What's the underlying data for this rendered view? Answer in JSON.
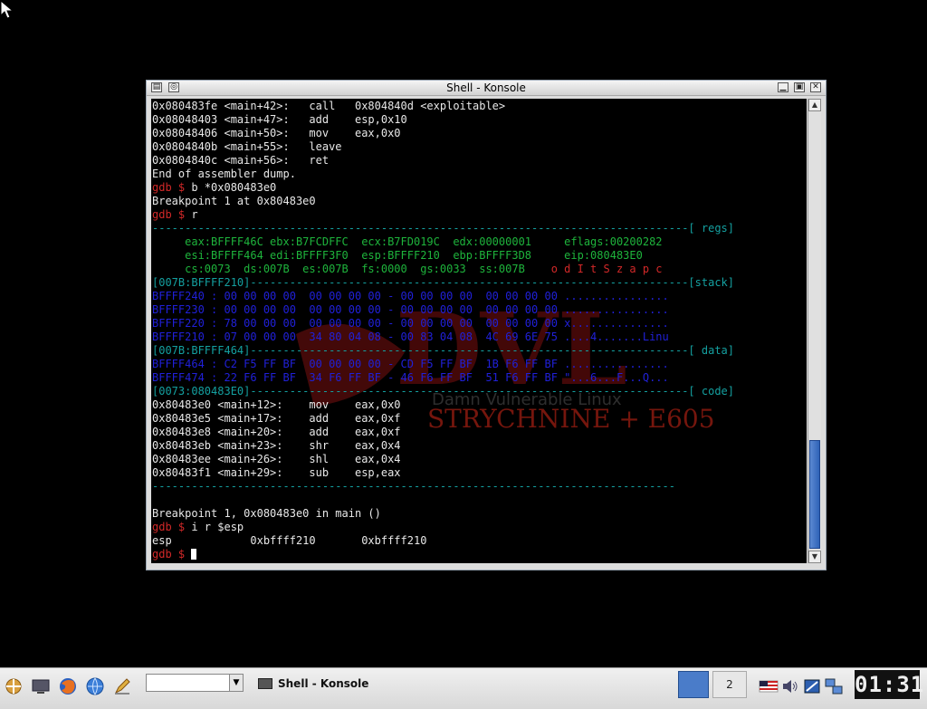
{
  "window": {
    "title": "Shell - Konsole"
  },
  "terminal": {
    "lines": [
      {
        "segments": [
          {
            "text": "0x080483fe <main+42>:   call   0x804840d <exploitable>",
            "cls": "c-white"
          }
        ]
      },
      {
        "segments": [
          {
            "text": "0x08048403 <main+47>:   add    esp,0x10",
            "cls": "c-white"
          }
        ]
      },
      {
        "segments": [
          {
            "text": "0x08048406 <main+50>:   mov    eax,0x0",
            "cls": "c-white"
          }
        ]
      },
      {
        "segments": [
          {
            "text": "0x0804840b <main+55>:   leave",
            "cls": "c-white"
          }
        ]
      },
      {
        "segments": [
          {
            "text": "0x0804840c <main+56>:   ret",
            "cls": "c-white"
          }
        ]
      },
      {
        "segments": [
          {
            "text": "End of assembler dump.",
            "cls": "c-white"
          }
        ]
      },
      {
        "segments": [
          {
            "text": "gdb $ ",
            "cls": "c-red"
          },
          {
            "text": "b *0x080483e0",
            "cls": "c-white"
          }
        ]
      },
      {
        "segments": [
          {
            "text": "Breakpoint 1 at 0x80483e0",
            "cls": "c-white"
          }
        ]
      },
      {
        "segments": [
          {
            "text": "gdb $ ",
            "cls": "c-red"
          },
          {
            "text": "r",
            "cls": "c-white"
          }
        ]
      },
      {
        "segments": [
          {
            "text": "----------------------------------------------------------------------------------[ regs]",
            "cls": "c-cyan"
          }
        ]
      },
      {
        "segments": [
          {
            "text": "     eax:BFFFF46C ebx:B7FCDFFC  ecx:B7FD019C  edx:00000001     eflags:00200282",
            "cls": "c-green"
          }
        ]
      },
      {
        "segments": [
          {
            "text": "     esi:BFFFF464 edi:BFFFF3F0  esp:BFFFF210  ebp:BFFFF3D8     eip:080483E0",
            "cls": "c-green"
          }
        ]
      },
      {
        "segments": [
          {
            "text": "     cs:0073  ds:007B  es:007B  fs:0000  gs:0033  ss:007B    ",
            "cls": "c-green"
          },
          {
            "text": "o d I t S z a p c",
            "cls": "c-red"
          }
        ]
      },
      {
        "segments": [
          {
            "text": "[007B:BFFFF210]-------------------------------------------------------------------[stack]",
            "cls": "c-cyan"
          }
        ]
      },
      {
        "segments": [
          {
            "text": "BFFFF240 : 00 00 00 00  00 00 00 00 - 00 00 00 00  00 00 00 00 ................",
            "cls": "c-blue"
          }
        ]
      },
      {
        "segments": [
          {
            "text": "BFFFF230 : 00 00 00 00  00 00 00 00 - 00 00 00 00  00 00 00 00 ................",
            "cls": "c-blue"
          }
        ]
      },
      {
        "segments": [
          {
            "text": "BFFFF220 : 78 00 00 00  00 00 00 00 - 00 00 00 00  00 00 00 00 x...............",
            "cls": "c-blue"
          }
        ]
      },
      {
        "segments": [
          {
            "text": "BFFFF210 : 07 00 00 00  34 80 04 08 - 00 83 04 08  4C 69 6E 75 ....4.......Linu",
            "cls": "c-blue"
          }
        ]
      },
      {
        "segments": [
          {
            "text": "[007B:BFFFF464]-------------------------------------------------------------------[ data]",
            "cls": "c-cyan"
          }
        ]
      },
      {
        "segments": [
          {
            "text": "BFFFF464 : C2 F5 FF BF  00 00 00 00 - CD F5 FF BF  1B F6 FF BF ................",
            "cls": "c-blue"
          }
        ]
      },
      {
        "segments": [
          {
            "text": "BFFFF474 : 22 F6 FF BF  34 F6 FF BF - 46 F6 FF BF  51 F6 FF BF \"...6...F...Q...",
            "cls": "c-blue"
          }
        ]
      },
      {
        "segments": [
          {
            "text": "[0073:080483E0]-------------------------------------------------------------------[ code]",
            "cls": "c-cyan"
          }
        ]
      },
      {
        "segments": [
          {
            "text": "0x80483e0 <main+12>:    mov    eax,0x0",
            "cls": "c-white"
          }
        ]
      },
      {
        "segments": [
          {
            "text": "0x80483e5 <main+17>:    add    eax,0xf",
            "cls": "c-white"
          }
        ]
      },
      {
        "segments": [
          {
            "text": "0x80483e8 <main+20>:    add    eax,0xf",
            "cls": "c-white"
          }
        ]
      },
      {
        "segments": [
          {
            "text": "0x80483eb <main+23>:    shr    eax,0x4",
            "cls": "c-white"
          }
        ]
      },
      {
        "segments": [
          {
            "text": "0x80483ee <main+26>:    shl    eax,0x4",
            "cls": "c-white"
          }
        ]
      },
      {
        "segments": [
          {
            "text": "0x80483f1 <main+29>:    sub    esp,eax",
            "cls": "c-white"
          }
        ]
      },
      {
        "segments": [
          {
            "text": "--------------------------------------------------------------------------------",
            "cls": "c-cyan"
          }
        ]
      },
      {
        "segments": [
          {
            "text": "",
            "cls": "c-white"
          }
        ]
      },
      {
        "segments": [
          {
            "text": "Breakpoint 1, 0x080483e0 in main ()",
            "cls": "c-white"
          }
        ]
      },
      {
        "segments": [
          {
            "text": "gdb $ ",
            "cls": "c-red"
          },
          {
            "text": "i r $esp",
            "cls": "c-white"
          }
        ]
      },
      {
        "segments": [
          {
            "text": "esp            0xbffff210       0xbffff210",
            "cls": "c-white"
          }
        ]
      },
      {
        "segments": [
          {
            "text": "gdb $ ",
            "cls": "c-red"
          }
        ],
        "cursor": true
      }
    ]
  },
  "watermark": {
    "logo": "DVL",
    "tagline": "Damn Vulnerable Linux",
    "subtitle": "STRYCHNINE + E605"
  },
  "taskbar": {
    "task_label": "Shell - Konsole",
    "desktop_number": "2",
    "clock": "01:31"
  },
  "icons": {
    "launcher": "kde-menu-icon",
    "desktop": "show-desktop-icon",
    "firefox": "firefox-icon",
    "browser": "konqueror-icon",
    "editor": "editor-icon"
  },
  "colors": {
    "prompt": "#d22828",
    "separator": "#14a0a0",
    "registers": "#1eb43c",
    "memory": "#2020d8",
    "scroll_thumb": "#2f63b8"
  }
}
